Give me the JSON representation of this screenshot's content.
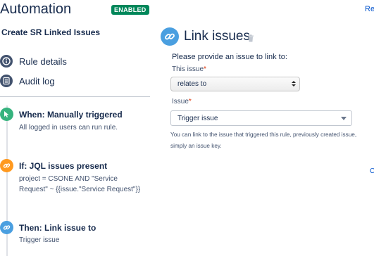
{
  "header": {
    "title": "Automation",
    "status_badge": "ENABLED",
    "top_right_link": "Re"
  },
  "rule": {
    "name": "Create SR Linked Issues"
  },
  "nav": {
    "items": [
      {
        "label": "Rule details",
        "icon": "info-icon"
      },
      {
        "label": "Audit log",
        "icon": "list-icon"
      }
    ]
  },
  "steps": [
    {
      "title": "When: Manually triggered",
      "description_lines": [
        "All logged in users can run rule."
      ],
      "icon": "cursor-icon",
      "color": "#36b37e"
    },
    {
      "title": "If: JQL issues present",
      "description_lines": [
        "project = CSONE AND \"Service",
        "Request\" ~ {{issue.\"Service Request\"}}"
      ],
      "icon": "link-icon",
      "color": "#ff991f"
    },
    {
      "title": "Then: Link issue to",
      "description_lines": [
        "Trigger issue"
      ],
      "icon": "link-icon",
      "color": "#4a9fe0"
    }
  ],
  "component": {
    "title": "Link issues",
    "icon": "link-icon",
    "delete_icon": "trash-icon",
    "prompt": "Please provide an issue to link to:",
    "this_issue_label": "This issue",
    "link_type_value": "relates to",
    "issue_label": "Issue",
    "issue_value": "Trigger issue",
    "help_lines": [
      "You can link to the issue that triggered this rule, previously created issue,",
      "simply an issue key."
    ],
    "edge_link": "C"
  },
  "colors": {
    "enabled_badge": "#00875a",
    "nav_icon": "#42526e",
    "required_asterisk": "#de350b"
  }
}
